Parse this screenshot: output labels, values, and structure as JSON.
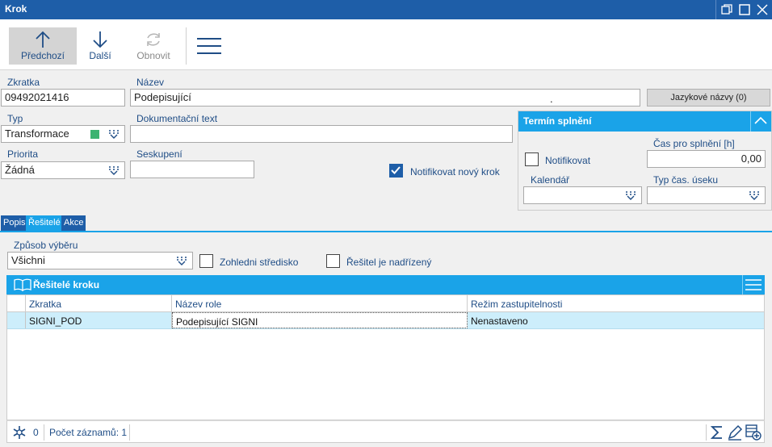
{
  "window": {
    "title": "Krok"
  },
  "toolbar": {
    "prev_label": "Předchozí",
    "next_label": "Další",
    "refresh_label": "Obnovit"
  },
  "form": {
    "zkratka_label": "Zkratka",
    "zkratka_value": "09492021416",
    "nazev_label": "Název",
    "nazev_value": "Podepisující",
    "nazev_trailing": ".",
    "lang_button": "Jazykové názvy (0)",
    "typ_label": "Typ",
    "typ_value": "Transformace",
    "typ_color": "#3cb371",
    "dok_label": "Dokumentační text",
    "dok_value": "",
    "priorita_label": "Priorita",
    "priorita_value": "Žádná",
    "seskupeni_label": "Seskupení",
    "seskupeni_value": "",
    "notif_new_label": "Notifikovat nový krok",
    "notif_new_checked": true
  },
  "termin": {
    "title": "Termín splnění",
    "notif_label": "Notifikovat",
    "notif_checked": false,
    "cas_label": "Čas pro splnění [h]",
    "cas_value": "0,00",
    "kalendar_label": "Kalendář",
    "kalendar_value": "",
    "typ_label": "Typ čas. úseku",
    "typ_value": ""
  },
  "tabs": [
    {
      "label": "Popis",
      "active": false
    },
    {
      "label": "Řešitelé",
      "active": true
    },
    {
      "label": "Akce",
      "active": false
    }
  ],
  "resitele": {
    "zpusob_label": "Způsob výběru",
    "zpusob_value": "Všichni",
    "zohledni_label": "Zohledni středisko",
    "zohledni_checked": false,
    "nadrizeny_label": "Řešitel je nadřízený",
    "nadrizeny_checked": false,
    "grid_title": "Řešitelé kroku",
    "columns": [
      "Zkratka",
      "Název role",
      "Režim zastupitelnosti"
    ],
    "rows": [
      [
        "SIGNI_POD",
        "Podepisující SIGNI",
        "Nenastaveno"
      ]
    ],
    "footer_count": "0",
    "footer_records": "Počet záznamů: 1"
  },
  "colors": {
    "titlebar": "#1e5ea8",
    "accent": "#1aa3e8",
    "selected_row": "#cdeefb"
  }
}
